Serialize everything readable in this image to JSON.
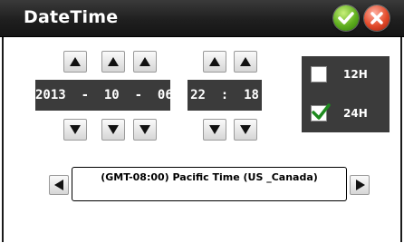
{
  "window": {
    "title": "DateTime",
    "ok_icon": "check-icon",
    "cancel_icon": "close-icon"
  },
  "date": {
    "year": "2013",
    "month": "10",
    "day": "06",
    "separator": "-"
  },
  "time": {
    "hour": "22",
    "minute": "18",
    "separator": ":"
  },
  "format": {
    "options": [
      {
        "label": "12H",
        "checked": false
      },
      {
        "label": "24H",
        "checked": true
      }
    ]
  },
  "timezone": {
    "value": "(GMT-08:00) Pacific Time (US _Canada)"
  },
  "colors": {
    "titlebar": "#1f1f1f",
    "panel": "#3b3b3b",
    "ok_green": "#5fae1e",
    "cancel_red": "#e24a2a",
    "check_green": "#1e8a1e"
  }
}
